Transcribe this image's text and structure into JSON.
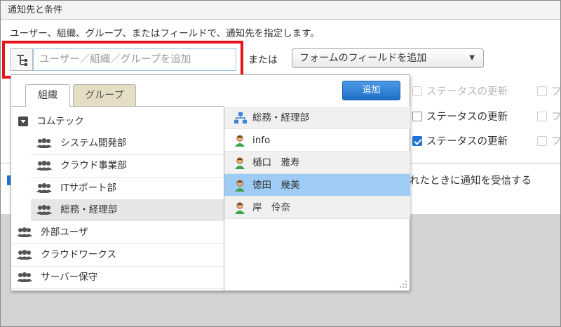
{
  "panel": {
    "title": "通知先と条件"
  },
  "instruction": "ユーザー、組織、グループ、またはフィールドで、通知先を指定します。",
  "entity_input": {
    "placeholder": "ユーザー／組織／グループを追加"
  },
  "or_label": "または",
  "field_select": {
    "selected": "フォームのフィールドを追加",
    "caret": "▼"
  },
  "background_rows": [
    {
      "label": "ステータスの更新",
      "checked": false,
      "faded": true
    },
    {
      "label": "ステータスの更新",
      "checked": false,
      "faded": false
    },
    {
      "label": "ステータスの更新",
      "checked": true,
      "faded": false
    }
  ],
  "receive_note": "れたときに通知を受信する",
  "popup": {
    "tabs": [
      {
        "label": "組織",
        "active": true
      },
      {
        "label": "グループ",
        "active": false
      }
    ],
    "add_button": "追加",
    "org_tree": [
      {
        "label": "コムテック",
        "level": 0,
        "icon": "collapse-toggle-icon",
        "selected": false
      },
      {
        "label": "システム開発部",
        "level": 1,
        "icon": "organization-icon",
        "selected": false
      },
      {
        "label": "クラウド事業部",
        "level": 1,
        "icon": "organization-icon",
        "selected": false
      },
      {
        "label": "ITサポート部",
        "level": 1,
        "icon": "organization-icon",
        "selected": false
      },
      {
        "label": "総務・経理部",
        "level": 1,
        "icon": "organization-icon",
        "selected": true
      },
      {
        "label": "外部ユーザ",
        "level": 0,
        "icon": "organization-icon",
        "selected": false
      },
      {
        "label": "クラウドワークス",
        "level": 0,
        "icon": "organization-icon",
        "selected": false
      },
      {
        "label": "サーバー保守",
        "level": 0,
        "icon": "organization-icon",
        "selected": false
      }
    ],
    "members": [
      {
        "label": "総務・経理部",
        "icon": "org-hierarchy-icon",
        "selected": false,
        "alt": true
      },
      {
        "label": "info",
        "icon": "user-icon",
        "selected": false,
        "alt": false
      },
      {
        "label": "樋口　雅寿",
        "icon": "user-icon",
        "selected": false,
        "alt": true
      },
      {
        "label": "徳田　幾美",
        "icon": "user-icon",
        "selected": true,
        "alt": false
      },
      {
        "label": "岸　伶奈",
        "icon": "user-icon",
        "selected": false,
        "alt": true
      }
    ]
  },
  "colors": {
    "highlight_border": "#e8141c",
    "accent_blue": "#1e73d4",
    "selected_member": "#9fccf5",
    "inactive_tab": "#e5ddc4"
  }
}
